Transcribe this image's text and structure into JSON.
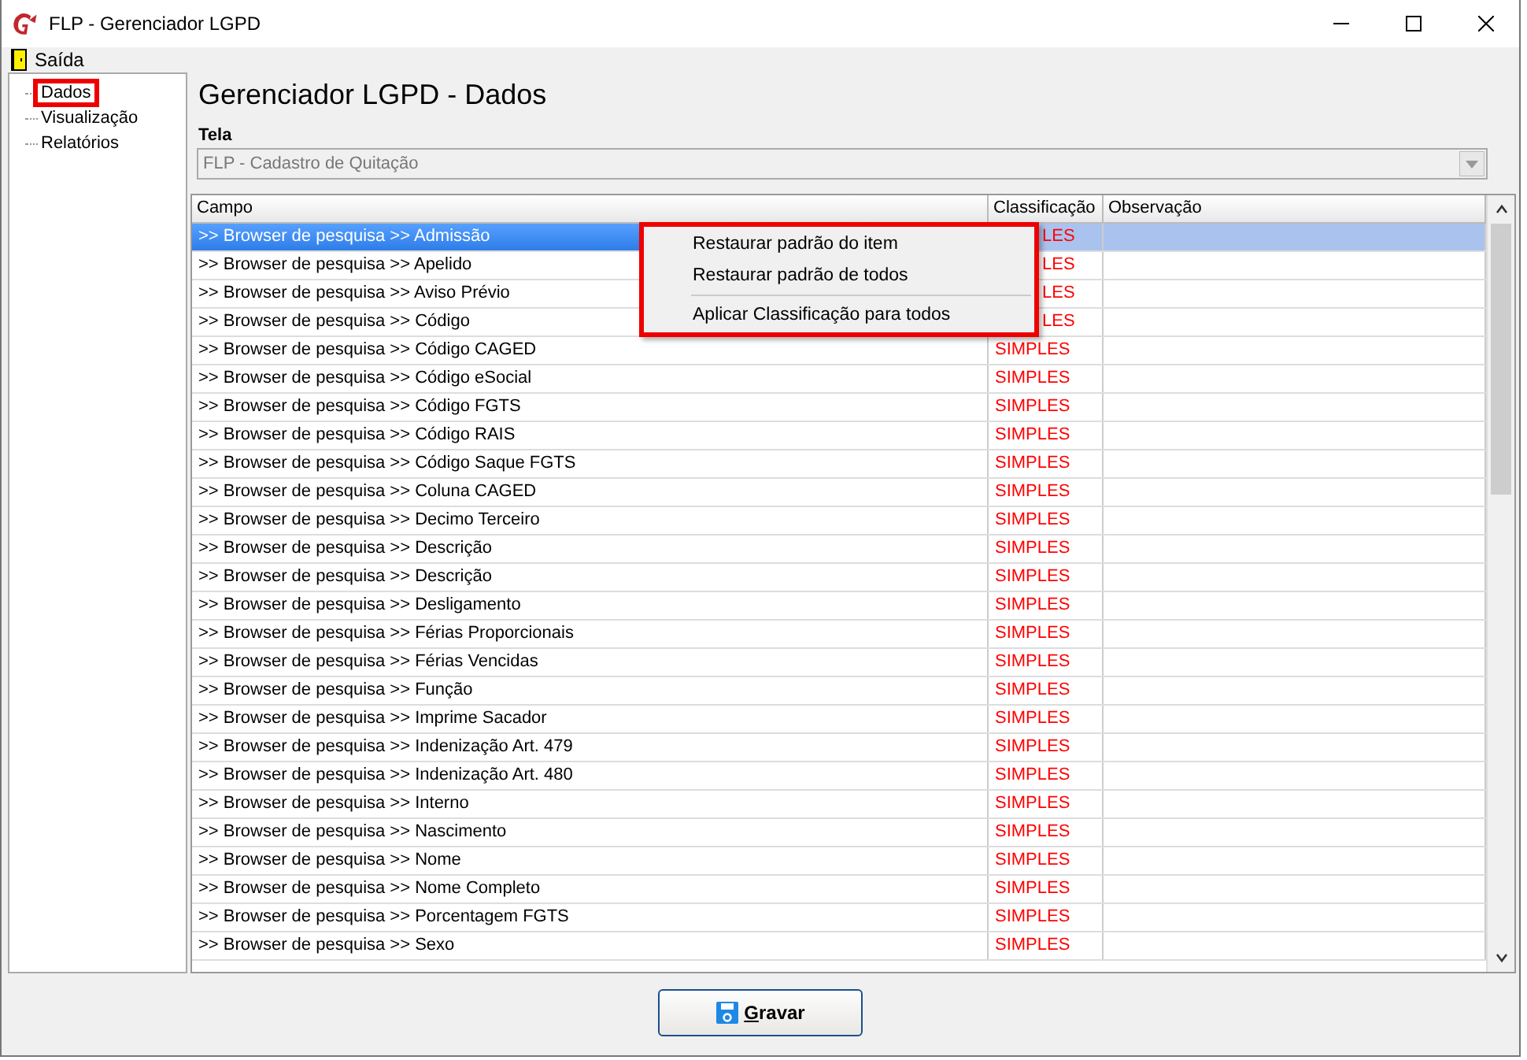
{
  "window": {
    "title": "FLP - Gerenciador LGPD"
  },
  "menu": [
    {
      "label": "Saída"
    }
  ],
  "tree": [
    {
      "label": "Dados",
      "selected": true
    },
    {
      "label": "Visualização",
      "selected": false
    },
    {
      "label": "Relatórios",
      "selected": false
    }
  ],
  "heading": "Gerenciador LGPD - Dados",
  "tela": {
    "label": "Tela",
    "value": "FLP - Cadastro de Quitação"
  },
  "table": {
    "columns": [
      "Campo",
      "Classificação",
      "Observação"
    ],
    "rows": [
      {
        "campo": ">> Browser de pesquisa >> Admissão",
        "classificacao": "LES",
        "partly_covered": true,
        "selected": true
      },
      {
        "campo": ">> Browser de pesquisa >> Apelido",
        "classificacao": "LES",
        "partly_covered": true,
        "selected": false
      },
      {
        "campo": ">> Browser de pesquisa >> Aviso Prévio",
        "classificacao": "LES",
        "partly_covered": true,
        "selected": false
      },
      {
        "campo": ">> Browser de pesquisa >> Código",
        "classificacao": "LES",
        "partly_covered": true,
        "selected": false
      },
      {
        "campo": ">> Browser de pesquisa >> Código CAGED",
        "classificacao": "SIMPLES",
        "selected": false
      },
      {
        "campo": ">> Browser de pesquisa >> Código eSocial",
        "classificacao": "SIMPLES",
        "selected": false
      },
      {
        "campo": ">> Browser de pesquisa >> Código FGTS",
        "classificacao": "SIMPLES",
        "selected": false
      },
      {
        "campo": ">> Browser de pesquisa >> Código RAIS",
        "classificacao": "SIMPLES",
        "selected": false
      },
      {
        "campo": ">> Browser de pesquisa >> Código Saque FGTS",
        "classificacao": "SIMPLES",
        "selected": false
      },
      {
        "campo": ">> Browser de pesquisa >> Coluna CAGED",
        "classificacao": "SIMPLES",
        "selected": false
      },
      {
        "campo": ">> Browser de pesquisa >> Decimo Terceiro",
        "classificacao": "SIMPLES",
        "selected": false
      },
      {
        "campo": ">> Browser de pesquisa >> Descrição",
        "classificacao": "SIMPLES",
        "selected": false
      },
      {
        "campo": ">> Browser de pesquisa >> Descrição",
        "classificacao": "SIMPLES",
        "selected": false
      },
      {
        "campo": ">> Browser de pesquisa >> Desligamento",
        "classificacao": "SIMPLES",
        "selected": false
      },
      {
        "campo": ">> Browser de pesquisa >> Férias Proporcionais",
        "classificacao": "SIMPLES",
        "selected": false
      },
      {
        "campo": ">> Browser de pesquisa >> Férias Vencidas",
        "classificacao": "SIMPLES",
        "selected": false
      },
      {
        "campo": ">> Browser de pesquisa >> Função",
        "classificacao": "SIMPLES",
        "selected": false
      },
      {
        "campo": ">> Browser de pesquisa >> Imprime Sacador",
        "classificacao": "SIMPLES",
        "selected": false
      },
      {
        "campo": ">> Browser de pesquisa >> Indenização Art. 479",
        "classificacao": "SIMPLES",
        "selected": false
      },
      {
        "campo": ">> Browser de pesquisa >> Indenização Art. 480",
        "classificacao": "SIMPLES",
        "selected": false
      },
      {
        "campo": ">> Browser de pesquisa >> Interno",
        "classificacao": "SIMPLES",
        "selected": false
      },
      {
        "campo": ">> Browser de pesquisa >> Nascimento",
        "classificacao": "SIMPLES",
        "selected": false
      },
      {
        "campo": ">> Browser de pesquisa >> Nome",
        "classificacao": "SIMPLES",
        "selected": false
      },
      {
        "campo": ">> Browser de pesquisa >> Nome Completo",
        "classificacao": "SIMPLES",
        "selected": false
      },
      {
        "campo": ">> Browser de pesquisa >> Porcentagem FGTS",
        "classificacao": "SIMPLES",
        "selected": false
      },
      {
        "campo": ">> Browser de pesquisa >> Sexo",
        "classificacao": "SIMPLES",
        "selected": false
      }
    ]
  },
  "context_menu": {
    "items": [
      {
        "label": "Restaurar padrão do item",
        "kind": "item"
      },
      {
        "label": "Restaurar padrão de todos",
        "kind": "item"
      },
      {
        "kind": "separator"
      },
      {
        "label": "Aplicar Classificação para todos",
        "kind": "item"
      }
    ]
  },
  "save_button": {
    "label": "Gravar"
  }
}
